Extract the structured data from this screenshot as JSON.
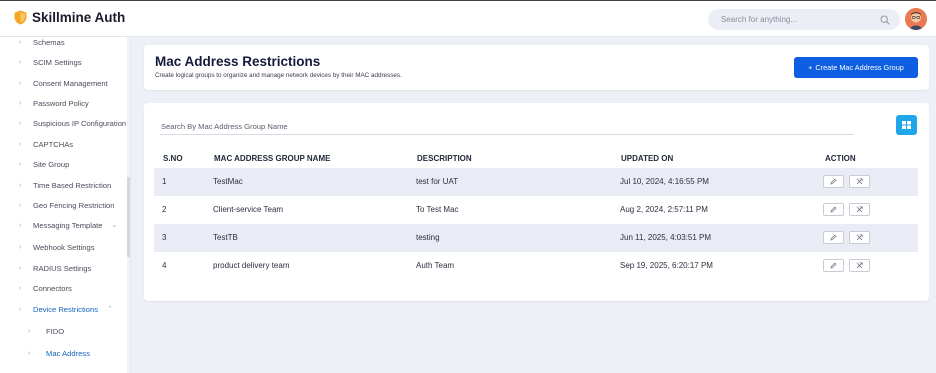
{
  "app": {
    "title": "Skillmine Auth"
  },
  "header": {
    "search": {
      "placeholder": "Search for anything...",
      "value": ""
    }
  },
  "sidebar": {
    "items": [
      {
        "label": "Schemas"
      },
      {
        "label": "SCIM Settings"
      },
      {
        "label": "Consent Management"
      },
      {
        "label": "Password Policy"
      },
      {
        "label": "Suspicious IP Configuration"
      },
      {
        "label": "CAPTCHAs"
      },
      {
        "label": "Site Group"
      },
      {
        "label": "Time Based Restriction"
      },
      {
        "label": "Geo Fencing Restriction"
      },
      {
        "label": "Messaging Template"
      },
      {
        "label": "Webhook Settings"
      },
      {
        "label": "RADIUS Settings"
      },
      {
        "label": "Connectors"
      },
      {
        "label": "Device Restrictions"
      },
      {
        "label": "FIDO"
      },
      {
        "label": "Mac Address"
      }
    ]
  },
  "page": {
    "title": "Mac Address Restrictions",
    "subtitle": "Create logical groups to organize and manage network devices by their MAC addresses.",
    "create_label": "Create Mac Address Group"
  },
  "table": {
    "search_placeholder": "Search By Mac Address Group Name",
    "columns": [
      "S.NO",
      "MAC ADDRESS GROUP NAME",
      "DESCRIPTION",
      "UPDATED ON",
      "ACTION"
    ],
    "rows": [
      {
        "sno": "1",
        "name": "TestMac",
        "description": "test for UAT",
        "updated": "Jul 10, 2024, 4:16:55 PM"
      },
      {
        "sno": "2",
        "name": "Client-service Team",
        "description": "To Test Mac",
        "updated": "Aug 2, 2024, 2:57:11 PM"
      },
      {
        "sno": "3",
        "name": "TestTB",
        "description": "testing",
        "updated": "Jun 11, 2025, 4:03:51 PM"
      },
      {
        "sno": "4",
        "name": "product delivery team",
        "description": "Auth Team",
        "updated": "Sep 19, 2025, 6:20:17 PM"
      }
    ]
  },
  "icons": {
    "brand": "shield-logo-icon",
    "search": "search-icon",
    "create": "plus-icon",
    "grid": "grid-view-icon",
    "edit": "pencil-icon",
    "delete": "delete-icon",
    "nav_arrow": "chevron-right-icon",
    "expand": "chevron-down-icon",
    "collapse": "chevron-up-icon"
  },
  "colors": {
    "primary": "#0d5ee0",
    "grid_button": "#1fa7e9",
    "active_nav": "#1565c0",
    "logo_shield": "#f5a623"
  }
}
